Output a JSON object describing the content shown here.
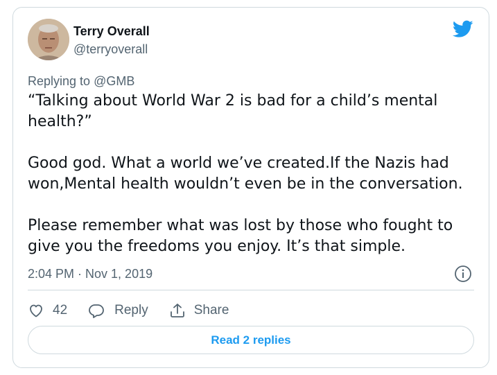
{
  "author": {
    "name": "Terry Overall",
    "handle": "@terryoverall"
  },
  "reply_context": {
    "prefix": "Replying to ",
    "handle": "@GMB"
  },
  "tweet": {
    "paragraphs": [
      "“Talking about World War 2 is bad for a child’s mental health?”",
      "Good god. What a world we’ve created.If the Nazis had won,Mental health wouldn’t even be in the conversation.",
      "Please remember what was lost by those who fought to give you the freedoms you enjoy. It’s that simple."
    ],
    "timestamp": "2:04 PM · Nov 1, 2019"
  },
  "actions": {
    "like_count": "42",
    "reply_label": "Reply",
    "share_label": "Share"
  },
  "read_replies_label": "Read 2 replies",
  "colors": {
    "brand": "#1d9bf0",
    "text": "#0f1419",
    "muted": "#536471",
    "border": "#cfd9de"
  },
  "icons": [
    "twitter-bird-icon",
    "info-icon",
    "heart-icon",
    "reply-bubble-icon",
    "share-icon"
  ]
}
